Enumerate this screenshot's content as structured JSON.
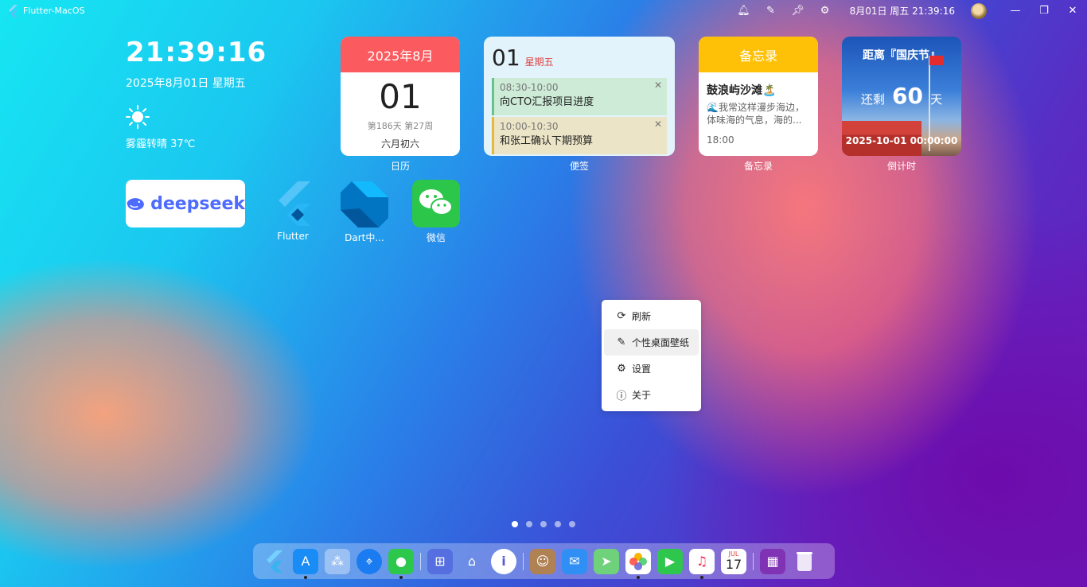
{
  "topbar": {
    "app_title": "Flutter-MacOS",
    "clock": "8月01日 周五 21:39:16",
    "icons": [
      "bell-icon",
      "magic-wand-icon",
      "pin-icon",
      "gear-icon"
    ],
    "window_buttons": [
      "minimize-icon",
      "restore-icon",
      "close-icon"
    ]
  },
  "clock_widget": {
    "time": "21:39:16",
    "date": "2025年8月01日 星期五",
    "weather": "雾霾转晴 37℃",
    "weather_icon": "sun-icon"
  },
  "calendar": {
    "header": "2025年8月",
    "day": "01",
    "meta": "第186天 第27周",
    "lunar": "六月初六",
    "label": "日历",
    "accent": "#fb5a5f"
  },
  "notes": {
    "day": "01",
    "weekday": "星期五",
    "label": "便签",
    "items": [
      {
        "time": "08:30-10:00",
        "text": "向CTO汇报项目进度"
      },
      {
        "time": "10:00-10:30",
        "text": "和张工确认下期预算"
      }
    ]
  },
  "memo": {
    "header": "备忘录",
    "title": "鼓浪屿沙滩🏝️",
    "body": "🌊我常这样漫步海边，体味海的气息，海的...",
    "time": "18:00",
    "label": "备忘录",
    "accent": "#ffc107"
  },
  "countdown": {
    "title": "距离『国庆节』",
    "prefix": "还剩",
    "days": "60",
    "suffix": "天",
    "date": "2025-10-01 00:00:00",
    "label": "倒计时"
  },
  "apps": {
    "deepseek": "deepseek",
    "flutter": "Flutter",
    "dart": "Dart中...",
    "wechat": "微信"
  },
  "context_menu": {
    "items": [
      {
        "label": "刷新",
        "icon": "refresh-icon"
      },
      {
        "label": "个性桌面壁纸",
        "icon": "magic-wand-icon"
      },
      {
        "label": "设置",
        "icon": "gear-icon"
      },
      {
        "label": "关于",
        "icon": "info-icon"
      }
    ]
  },
  "pager": {
    "pages": 5,
    "current": 1
  },
  "dock": {
    "icons": [
      "flutter-icon",
      "app-store-icon",
      "launchpad-icon",
      "safari-icon",
      "messages-icon",
      "apps-grid-icon",
      "home-icon",
      "info-icon",
      "contacts-icon",
      "mail-icon",
      "maps-icon",
      "photos-icon",
      "facetime-icon",
      "music-icon",
      "calendar-icon",
      "folder-icon",
      "trash-icon"
    ],
    "calendar_month": "JUL",
    "calendar_day": "17"
  }
}
